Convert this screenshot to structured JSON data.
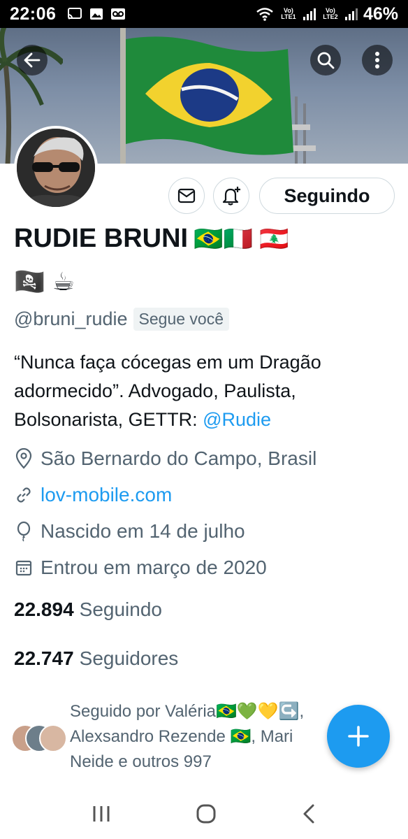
{
  "status_bar": {
    "time": "22:06",
    "sim1_label": "Vo) LTE1",
    "sim2_label": "Vo) LTE2",
    "battery": "46%",
    "icons": [
      "cast-icon",
      "image-icon",
      "voicemail-icon",
      "wifi-icon",
      "signal-icon",
      "battery-icon"
    ]
  },
  "header": {
    "back_icon": "arrow-left-icon",
    "search_icon": "search-icon",
    "more_icon": "more-vertical-icon"
  },
  "profile": {
    "name": "RUDIE BRUNI",
    "name_emojis": "🇧🇷🇮🇹 🇱🇧",
    "extra_emojis": "🏴‍☠️ ☕",
    "handle": "@bruni_rudie",
    "follows_you": "Segue você",
    "follow_button": "Seguindo",
    "bio_text": "“Nunca faça cócegas em um Dragão adormecido”. Advogado, Paulista, Bolsonarista, GETTR: ",
    "bio_link": "@Rudie",
    "location": "São Bernardo do Campo, Brasil",
    "website": "lov-mobile.com",
    "birthday": "Nascido em 14 de julho",
    "joined": "Entrou em março de 2020",
    "following_count": "22.894",
    "following_label": "Seguindo",
    "followers_count": "22.747",
    "followers_label": "Seguidores",
    "followed_by": "Seguido por Valéria🇧🇷💚💛↪️, Alexsandro Rezende 🇧🇷, Mari Neide e outros 997"
  },
  "colors": {
    "accent": "#1d9bf0",
    "text_primary": "#0f1419",
    "text_secondary": "#536471",
    "border": "#cfd9de"
  }
}
